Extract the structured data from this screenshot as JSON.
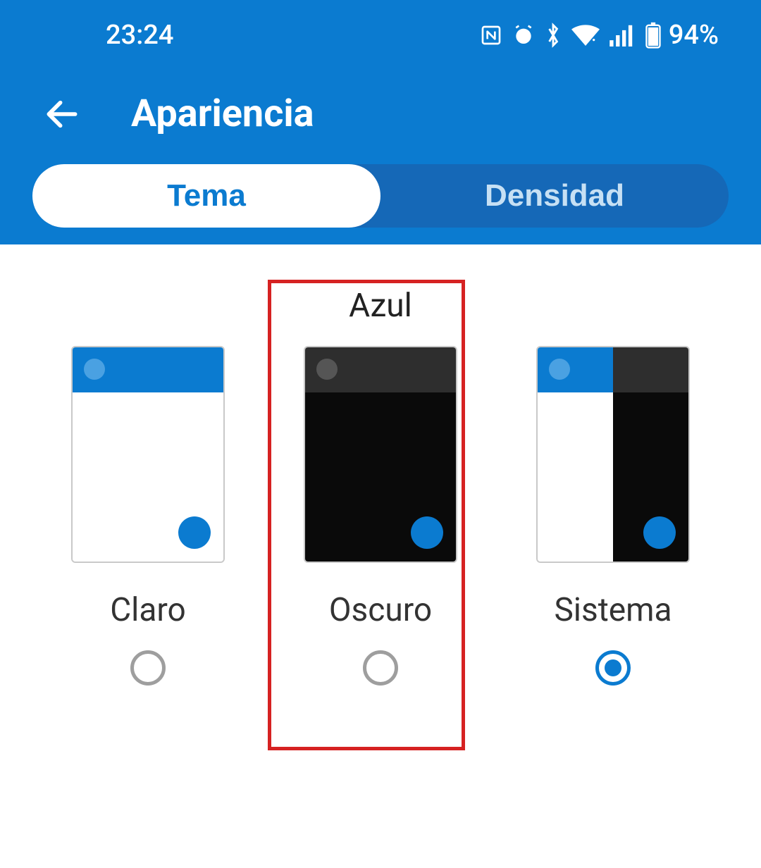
{
  "statusbar": {
    "time": "23:24",
    "battery_percent": "94%"
  },
  "header": {
    "title": "Apariencia"
  },
  "tabs": {
    "theme": "Tema",
    "density": "Densidad"
  },
  "accent": {
    "label": "Azul"
  },
  "theme_options": {
    "light": "Claro",
    "dark": "Oscuro",
    "system": "Sistema"
  },
  "colors": {
    "primary": "#0b7bd0",
    "highlight": "#d62222"
  }
}
